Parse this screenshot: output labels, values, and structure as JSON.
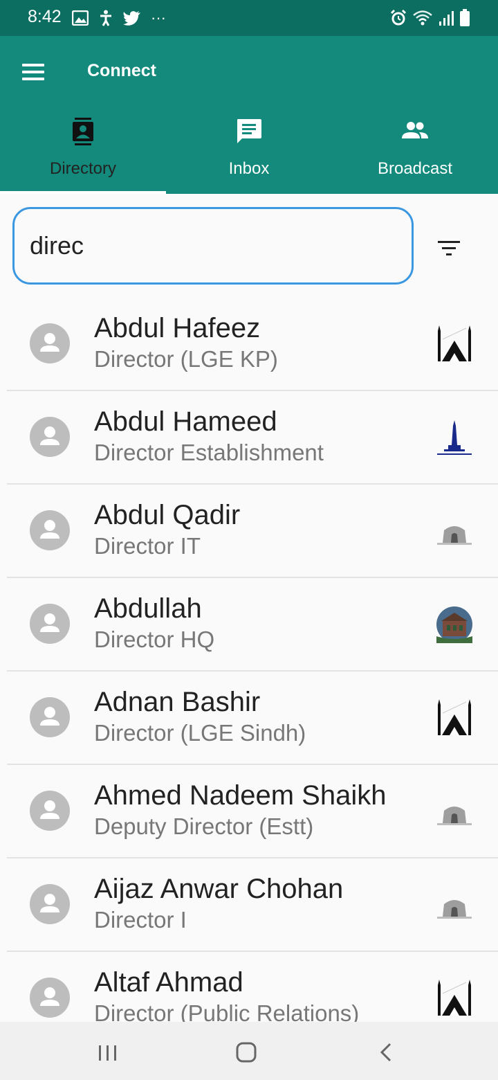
{
  "status_bar": {
    "time": "8:42",
    "left_icons": [
      "gallery-icon",
      "accessibility-icon",
      "twitter-icon",
      "more-dots-icon"
    ],
    "right_icons": [
      "alarm-icon",
      "wifi-icon",
      "signal-icon",
      "battery-icon"
    ],
    "more_dots": "···"
  },
  "app_bar": {
    "title": "Connect",
    "bg_color": "#138a7b",
    "tabs": [
      {
        "label": "Directory",
        "icon": "contacts-icon",
        "selected": true
      },
      {
        "label": "Inbox",
        "icon": "message-icon",
        "selected": false
      },
      {
        "label": "Broadcast",
        "icon": "group-icon",
        "selected": false
      }
    ]
  },
  "search": {
    "value": "direc",
    "placeholder": "",
    "border_color": "#3a97e0"
  },
  "contacts": [
    {
      "name": "Abdul Hafeez",
      "title": "Director (LGE KP)",
      "logo": "mosque-logo-icon"
    },
    {
      "name": "Abdul Hameed",
      "title": "Director Establishment",
      "logo": "minar-logo-icon"
    },
    {
      "name": "Abdul Qadir",
      "title": "Director IT",
      "logo": "mausoleum-logo-icon"
    },
    {
      "name": "Abdullah",
      "title": "Director HQ",
      "logo": "building-photo-logo-icon"
    },
    {
      "name": "Adnan Bashir",
      "title": "Director (LGE Sindh)",
      "logo": "mosque-logo-icon"
    },
    {
      "name": "Ahmed Nadeem Shaikh",
      "title": "Deputy Director (Estt)",
      "logo": "mausoleum-logo-icon"
    },
    {
      "name": "Aijaz Anwar Chohan",
      "title": "Director I",
      "logo": "mausoleum-logo-icon"
    },
    {
      "name": "Altaf Ahmad",
      "title": "Director (Public Relations)",
      "logo": "mosque-logo-icon"
    }
  ],
  "nav_bar": {
    "buttons": [
      "recent-apps-icon",
      "home-icon",
      "back-icon"
    ]
  }
}
